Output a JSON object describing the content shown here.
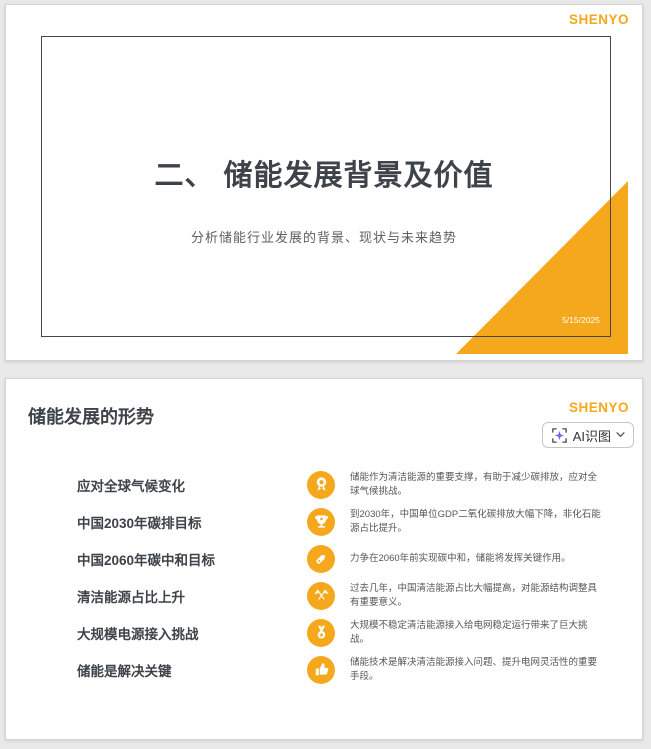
{
  "colors": {
    "accent": "#F5A81C",
    "title_text": "#3E4349",
    "body_text": "#565656",
    "page_bg": "#E9E9E9",
    "frame_border": "#474747",
    "purple": "#7C5CF6"
  },
  "brand": {
    "logo": "SHENYO"
  },
  "slide1": {
    "title": "二、 储能发展背景及价值",
    "subtitle": "分析储能行业发展的背景、现状与未来趋势",
    "date": "5/15/2025"
  },
  "slide2": {
    "title": "储能发展的形势",
    "ai_button": {
      "label": "AI识图"
    },
    "items": [
      {
        "icon": "award-rosette-icon",
        "label": "应对全球气候变化",
        "desc": "储能作为清洁能源的重要支撑，有助于减少碳排放，应对全球气候挑战。"
      },
      {
        "icon": "trophy-icon",
        "label": "中国2030年碳排目标",
        "desc": "到2030年，中国单位GDP二氧化碳排放大幅下降，非化石能源占比提升。"
      },
      {
        "icon": "tag-icon",
        "label": "中国2060年碳中和目标",
        "desc": "力争在2060年前实现碳中和，储能将发挥关键作用。"
      },
      {
        "icon": "crossed-flags-icon",
        "label": "清洁能源占比上升",
        "desc": "过去几年，中国清洁能源占比大幅提高，对能源结构调整具有重要意义。"
      },
      {
        "icon": "medal-star-icon",
        "label": "大规模电源接入挑战",
        "desc": "大规模不稳定清洁能源接入给电网稳定运行带来了巨大挑战。"
      },
      {
        "icon": "thumbs-up-icon",
        "label": "储能是解决关键",
        "desc": "储能技术是解决清洁能源接入问题、提升电网灵活性的重要手段。"
      }
    ]
  }
}
